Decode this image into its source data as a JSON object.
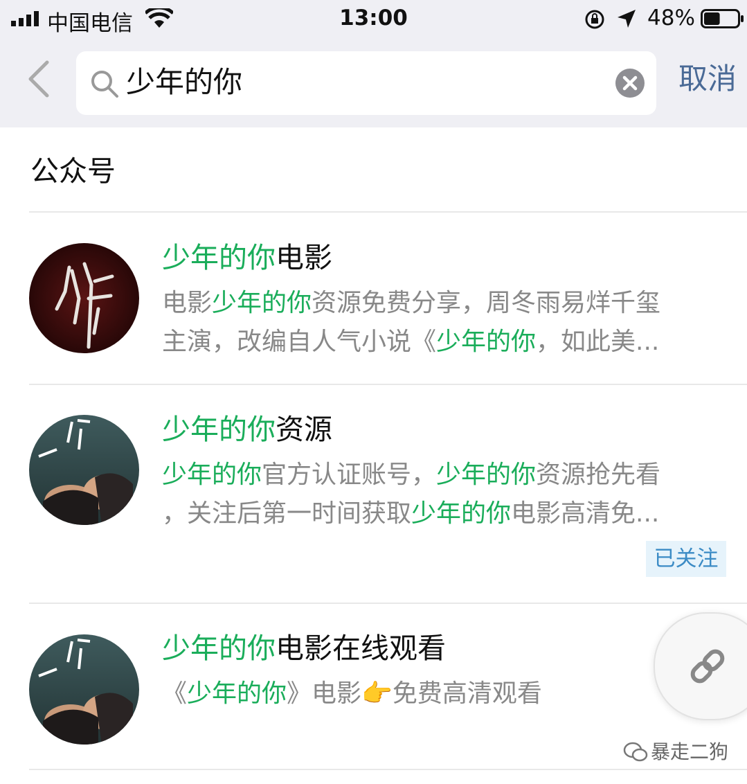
{
  "status_bar": {
    "carrier": "中国电信",
    "time": "13:00",
    "battery_percent": "48%",
    "battery_level": 0.48,
    "icons": [
      "signal-icon",
      "wifi-icon",
      "rotation-lock-icon",
      "location-icon",
      "battery-icon"
    ]
  },
  "search": {
    "query": "少年的你",
    "cancel_label": "取消",
    "icons": [
      "back-chevron-icon",
      "search-icon",
      "clear-icon"
    ]
  },
  "section": {
    "title": "公众号"
  },
  "results": [
    {
      "title_highlight": "少年的你",
      "title_rest": "电影",
      "desc_line1": [
        {
          "text": "电影",
          "hl": false
        },
        {
          "text": "少年的你",
          "hl": true
        },
        {
          "text": "资源免费分享，周冬雨易烊千玺",
          "hl": false
        }
      ],
      "desc_line2": [
        {
          "text": "主演，改编自人气小说《",
          "hl": false
        },
        {
          "text": "少年的你",
          "hl": true
        },
        {
          "text": "，如此美...",
          "hl": false
        }
      ]
    },
    {
      "title_highlight": "少年的你",
      "title_rest": "资源",
      "desc_line1": [
        {
          "text": "少年的你",
          "hl": true
        },
        {
          "text": "官方认证账号，",
          "hl": false
        },
        {
          "text": "少年的你",
          "hl": true
        },
        {
          "text": "资源抢先看",
          "hl": false
        }
      ],
      "desc_line2": [
        {
          "text": "，关注后第一时间获取",
          "hl": false
        },
        {
          "text": "少年的你",
          "hl": true
        },
        {
          "text": "电影高清免...",
          "hl": false
        }
      ],
      "badge": "已关注"
    },
    {
      "title_highlight": "少年的你",
      "title_rest": "电影在线观看",
      "desc_line1": [
        {
          "text": "《",
          "hl": false
        },
        {
          "text": "少年的你",
          "hl": true
        },
        {
          "text": "》电影",
          "hl": false
        },
        {
          "text": "👉",
          "hl": false,
          "emoji": true
        },
        {
          "text": "免费高清观看",
          "hl": false
        }
      ]
    }
  ],
  "float_button": {
    "icon": "link-icon"
  },
  "watermark": {
    "text": "暴走二狗",
    "icon": "wechat-icon"
  },
  "colors": {
    "highlight": "#1aad5a",
    "cancel": "#4a6a96",
    "badge_bg": "#e6f3fb",
    "badge_text": "#3b8bc5",
    "header_bg": "#efeff4"
  }
}
